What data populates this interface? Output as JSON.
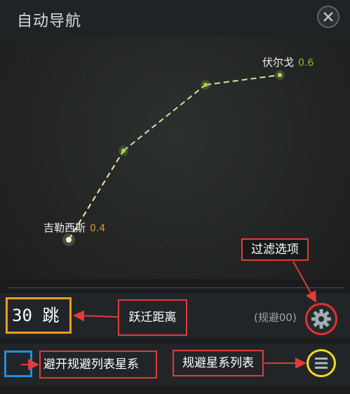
{
  "window": {
    "title": "自动导航"
  },
  "route": {
    "origin": {
      "name": "吉勒西斯",
      "security": "0.4",
      "security_color": "#d29b2c"
    },
    "destination": {
      "name": "伏尔戈",
      "security": "0.6",
      "security_color": "#8dbb2f"
    },
    "line_color": "#bfe8a0"
  },
  "jumps": {
    "label": "30 跳"
  },
  "avoid": {
    "count_label": "(规避00)",
    "toggle_label": "避开规避列表星系"
  },
  "annotations": {
    "filter_options": "过滤选项",
    "jump_distance": "跃迁距离",
    "avoid_list": "规避星系列表"
  },
  "colors": {
    "annotation_red": "#e23b3b",
    "jump_box_orange": "#f39a1f",
    "checkbox_blue": "#1f8fe0",
    "list_button_yellow": "#f5dc1e"
  }
}
